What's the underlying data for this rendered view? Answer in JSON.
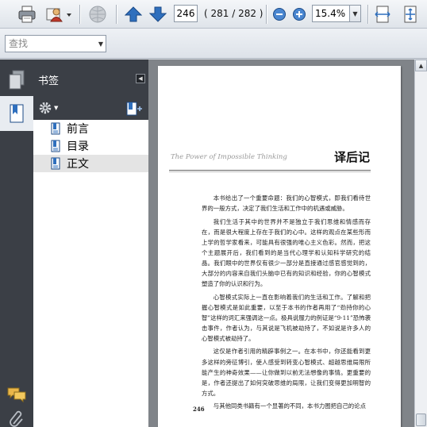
{
  "toolbar": {
    "current_page": "246",
    "page_count_text": "( 281 / 282 )",
    "zoom": "15.4%"
  },
  "find": {
    "placeholder": "查找"
  },
  "bookmarks_panel": {
    "title": "书签",
    "items": [
      {
        "label": "前言",
        "selected": false
      },
      {
        "label": "目录",
        "selected": false
      },
      {
        "label": "正文",
        "selected": true
      }
    ]
  },
  "document": {
    "running_head": "The Power of Impossible Thinking",
    "chapter_title": "译后记",
    "paragraphs": [
      "本书给出了一个重要命题：我们的心智模式，即我们看待世界的一般方式，决定了我们生活和工作中的机遇或威胁。",
      "我们生活于其中的世界并不是独立于我们思维和情感而存在，而是很大程度上存在于我们的心中。这样的观点在某些形而上学的哲学家看来，可能具有很强的唯心主义色彩。然而，把这个主题展开后，我们看到的是当代心理学和认知科学研究的结晶。我们眼中的世界仅有很少一部分是直接通过感官感觉到的，大部分的内容来自我们头脑中已有的知识和经验，你的心智模式塑造了你的认识和行为。",
      "心智模式实际上一直在影响着我们的生活和工作。了解和把握心智模式是如此重要，以至于本书的作者再用了“劲持你的心智”这样的词汇来强调这一点。极具说服力的例证是“9·11”恐怖袭击事件，作者认为，与其说是飞机被劫持了，不如说是许多人的心智模式被劫持了。",
      "这仅是作者引用的精辟事例之一。在本书中，你还能看到更多这样的旁征博引，使人感受到转变心智模式、超越思维局限所能产生的神奇效果——让你做到以前无法想像的事情。更重要的是，作者还提出了如何突破思维的局限，让我们变得更加明智的方式。",
      "与其他同类书籍有一个显著的不同，本书力图把自己的论点"
    ],
    "page_number": "246"
  },
  "colors": {
    "rail": "#3b3f46",
    "toolbar_top": "#f4f6f9",
    "icon_blue": "#2f6fbd"
  }
}
